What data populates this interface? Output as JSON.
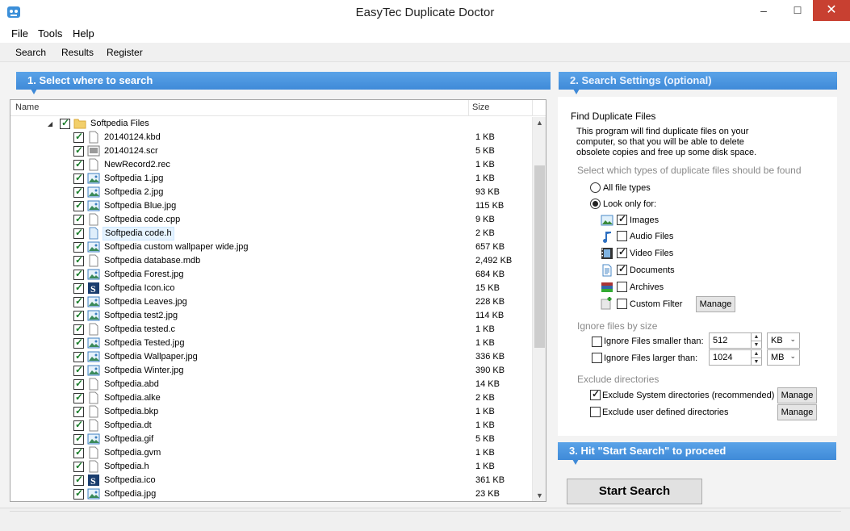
{
  "window": {
    "title": "EasyTec Duplicate Doctor",
    "minimize": "–",
    "maximize": "☐",
    "close": "✕"
  },
  "menu": {
    "file": "File",
    "tools": "Tools",
    "help": "Help"
  },
  "toolbar": {
    "search": "Search",
    "results": "Results",
    "register": "Register"
  },
  "section1": {
    "title": "1. Select where to search"
  },
  "tree": {
    "col_name": "Name",
    "col_size": "Size",
    "root": {
      "name": "Softpedia Files",
      "expander": "◢"
    },
    "files": [
      {
        "name": "20140124.kbd",
        "size": "1 KB",
        "icon": "doc"
      },
      {
        "name": "20140124.scr",
        "size": "5 KB",
        "icon": "scr"
      },
      {
        "name": "NewRecord2.rec",
        "size": "1 KB",
        "icon": "doc"
      },
      {
        "name": "Softpedia 1.jpg",
        "size": "1 KB",
        "icon": "img"
      },
      {
        "name": "Softpedia 2.jpg",
        "size": "93 KB",
        "icon": "img"
      },
      {
        "name": "Softpedia Blue.jpg",
        "size": "115 KB",
        "icon": "img"
      },
      {
        "name": "Softpedia code.cpp",
        "size": "9 KB",
        "icon": "doc"
      },
      {
        "name": "Softpedia code.h",
        "size": "2 KB",
        "icon": "h"
      },
      {
        "name": "Softpedia custom wallpaper wide.jpg",
        "size": "657 KB",
        "icon": "img"
      },
      {
        "name": "Softpedia database.mdb",
        "size": "2,492 KB",
        "icon": "doc"
      },
      {
        "name": "Softpedia Forest.jpg",
        "size": "684 KB",
        "icon": "img"
      },
      {
        "name": "Softpedia Icon.ico",
        "size": "15 KB",
        "icon": "s"
      },
      {
        "name": "Softpedia Leaves.jpg",
        "size": "228 KB",
        "icon": "img"
      },
      {
        "name": "Softpedia test2.jpg",
        "size": "114 KB",
        "icon": "img"
      },
      {
        "name": "Softpedia tested.c",
        "size": "1 KB",
        "icon": "doc"
      },
      {
        "name": "Softpedia Tested.jpg",
        "size": "1 KB",
        "icon": "img"
      },
      {
        "name": "Softpedia Wallpaper.jpg",
        "size": "336 KB",
        "icon": "img"
      },
      {
        "name": "Softpedia Winter.jpg",
        "size": "390 KB",
        "icon": "img"
      },
      {
        "name": "Softpedia.abd",
        "size": "14 KB",
        "icon": "doc"
      },
      {
        "name": "Softpedia.alke",
        "size": "2 KB",
        "icon": "doc"
      },
      {
        "name": "Softpedia.bkp",
        "size": "1 KB",
        "icon": "doc"
      },
      {
        "name": "Softpedia.dt",
        "size": "1 KB",
        "icon": "doc"
      },
      {
        "name": "Softpedia.gif",
        "size": "5 KB",
        "icon": "img"
      },
      {
        "name": "Softpedia.gvm",
        "size": "1 KB",
        "icon": "doc"
      },
      {
        "name": "Softpedia.h",
        "size": "1 KB",
        "icon": "doc"
      },
      {
        "name": "Softpedia.ico",
        "size": "361 KB",
        "icon": "s"
      },
      {
        "name": "Softpedia.jpg",
        "size": "23 KB",
        "icon": "img"
      }
    ],
    "selected_index": 7,
    "scroll_up": "▲",
    "scroll_down": "▼"
  },
  "section2": {
    "title": "2. Search Settings (optional)",
    "find_heading": "Find Duplicate Files",
    "desc_lines": [
      "This program will find duplicate files on your",
      "computer, so that you will be able to delete",
      "obsolete copies and free up some disk space."
    ],
    "types_heading": "Select which types of duplicate files should be found",
    "all_types": "All file types",
    "look_only": "Look only for:",
    "types": [
      {
        "label": "Images",
        "checked": true,
        "icon": "images-icon"
      },
      {
        "label": "Audio Files",
        "checked": false,
        "icon": "audio-icon"
      },
      {
        "label": "Video Files",
        "checked": true,
        "icon": "video-icon"
      },
      {
        "label": "Documents",
        "checked": true,
        "icon": "documents-icon"
      },
      {
        "label": "Archives",
        "checked": false,
        "icon": "archives-icon"
      },
      {
        "label": "Custom Filter",
        "checked": false,
        "icon": "custom-filter-icon"
      }
    ],
    "manage": "Manage",
    "size_heading": "Ignore files by size",
    "smaller_label": "Ignore Files smaller than:",
    "smaller_value": "512",
    "smaller_unit": "KB",
    "larger_label": "Ignore Files larger than:",
    "larger_value": "1024",
    "larger_unit": "MB",
    "exclude_heading": "Exclude directories",
    "exclude_system": "Exclude System directories (recommended)",
    "exclude_user": "Exclude user defined directories"
  },
  "section3": {
    "title": "3. Hit \"Start Search\" to proceed",
    "start_button": "Start Search"
  }
}
